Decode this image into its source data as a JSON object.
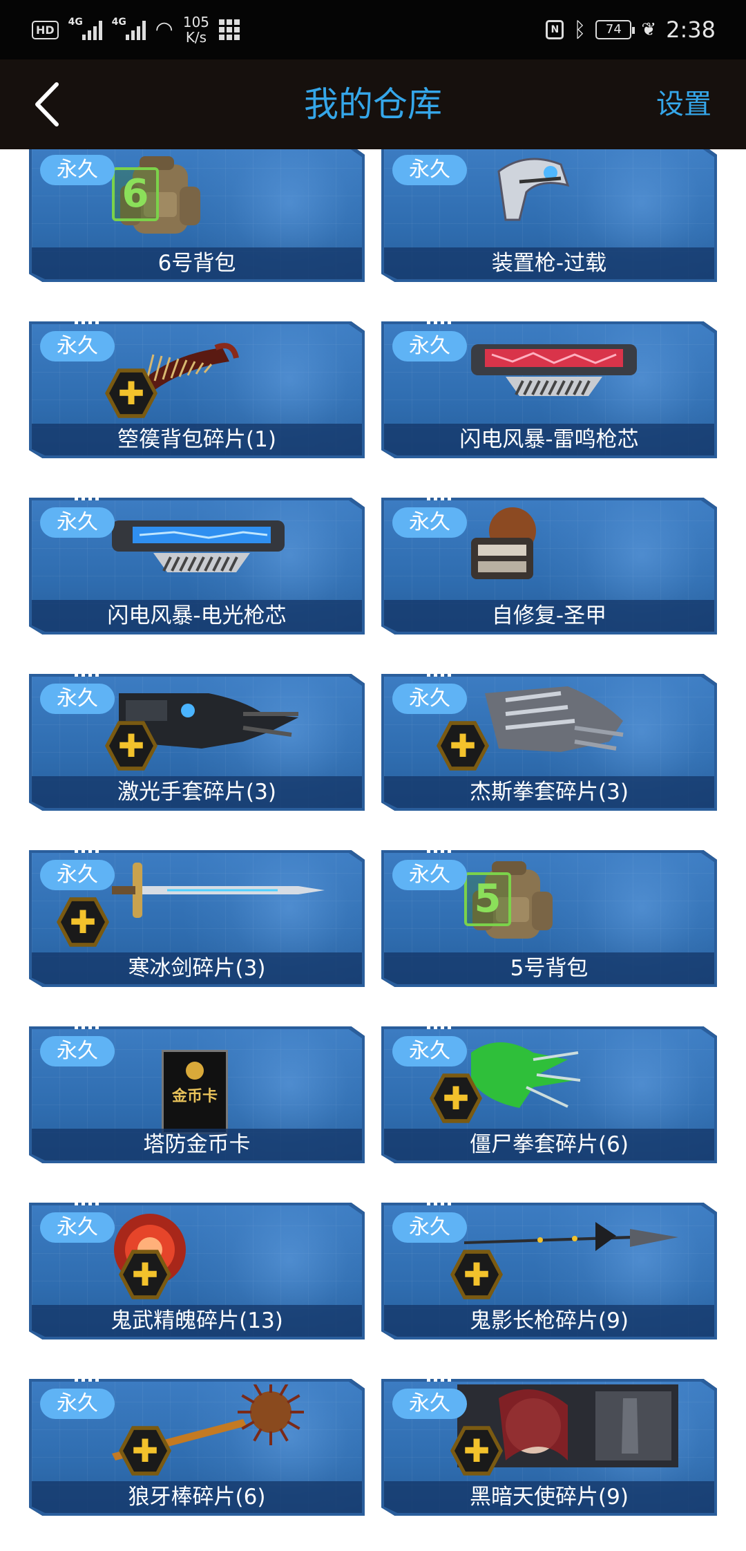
{
  "status_bar": {
    "hd": "HD",
    "net1": "4G",
    "net2": "4G",
    "speed_value": "105",
    "speed_unit": "K/s",
    "nfc": "N",
    "battery": "74",
    "time": "2:38"
  },
  "header": {
    "title": "我的仓库",
    "settings": "设置"
  },
  "items": [
    {
      "badge": "永久",
      "label": "6号背包",
      "art": "backpack",
      "number": "6",
      "fragment": false
    },
    {
      "badge": "永久",
      "label": "装置枪-过载",
      "art": "device-gun",
      "fragment": false
    },
    {
      "badge": "永久",
      "label": "箜篌背包碎片(1)",
      "art": "harp",
      "fragment": true
    },
    {
      "badge": "永久",
      "label": "闪电风暴-雷鸣枪芯",
      "art": "gun-core-red",
      "fragment": false
    },
    {
      "badge": "永久",
      "label": "闪电风暴-电光枪芯",
      "art": "gun-core-blue",
      "fragment": false
    },
    {
      "badge": "永久",
      "label": "自修复-圣甲",
      "art": "armor",
      "fragment": false
    },
    {
      "badge": "永久",
      "label": "激光手套碎片(3)",
      "art": "glove-dark",
      "fragment": true
    },
    {
      "badge": "永久",
      "label": "杰斯拳套碎片(3)",
      "art": "glove-silver",
      "fragment": true
    },
    {
      "badge": "永久",
      "label": "寒冰剑碎片(3)",
      "art": "sword",
      "fragment": true
    },
    {
      "badge": "永久",
      "label": "5号背包",
      "art": "backpack",
      "number": "5",
      "fragment": false
    },
    {
      "badge": "永久",
      "label": "塔防金币卡",
      "art": "coin-card",
      "card_text": "金币卡",
      "fragment": false
    },
    {
      "badge": "永久",
      "label": "僵尸拳套碎片(6)",
      "art": "glove-green",
      "fragment": true
    },
    {
      "badge": "永久",
      "label": "鬼武精魄碎片(13)",
      "art": "orb",
      "fragment": true
    },
    {
      "badge": "永久",
      "label": "鬼影长枪碎片(9)",
      "art": "spear",
      "fragment": true
    },
    {
      "badge": "永久",
      "label": "狼牙棒碎片(6)",
      "art": "mace",
      "fragment": true
    },
    {
      "badge": "永久",
      "label": "黑暗天使碎片(9)",
      "art": "portrait",
      "fragment": true
    }
  ]
}
